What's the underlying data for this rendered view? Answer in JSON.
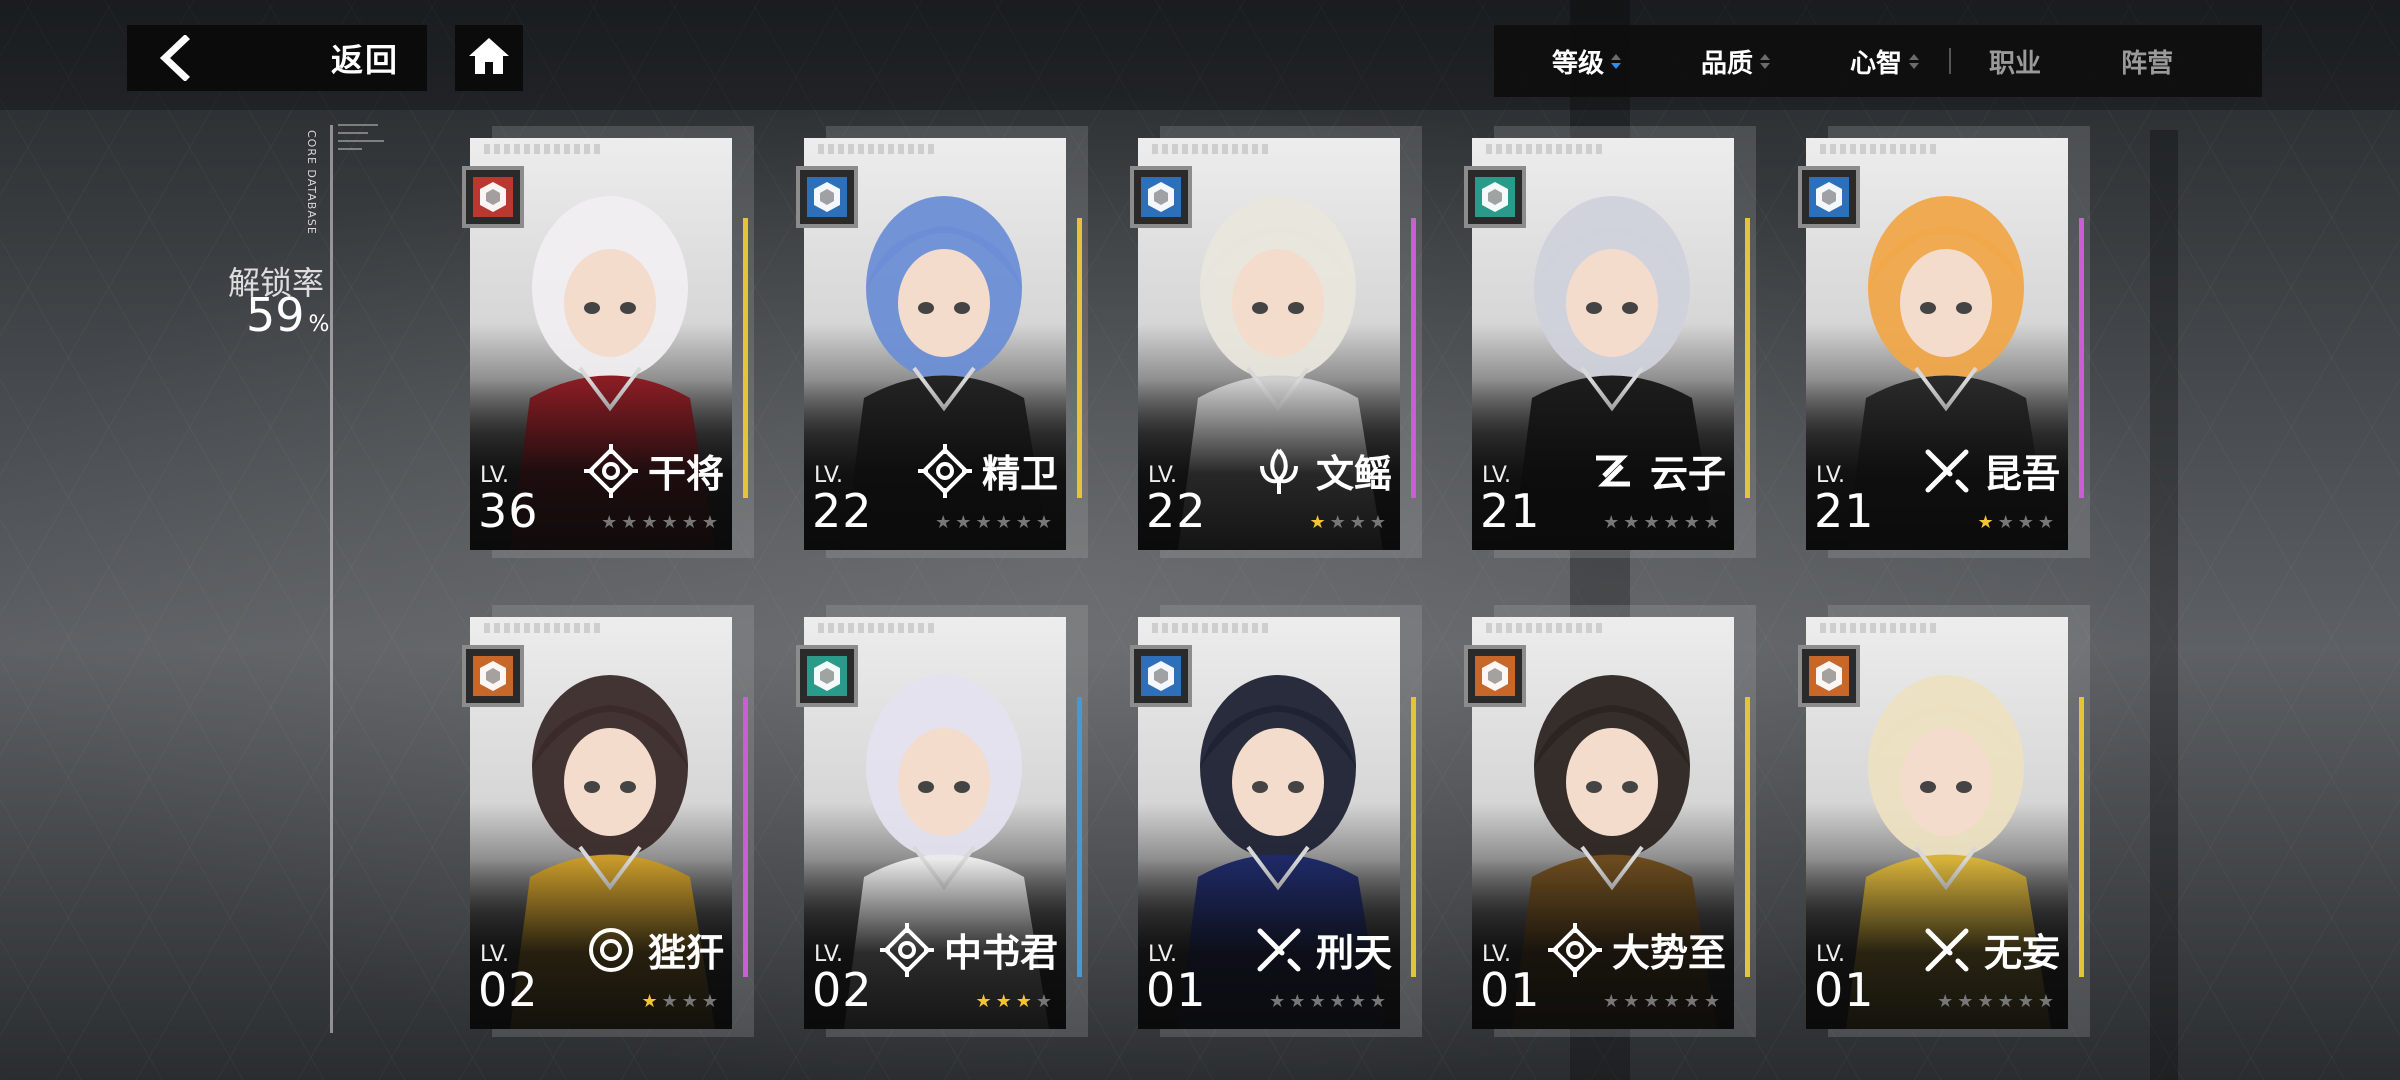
{
  "nav": {
    "back_label": "返回"
  },
  "sort": {
    "items": [
      {
        "label": "等级"
      },
      {
        "label": "品质"
      },
      {
        "label": "心智"
      }
    ],
    "filters": [
      {
        "label": "职业"
      },
      {
        "label": "阵营"
      }
    ]
  },
  "side": {
    "database_label": "CORE DATABASE",
    "unlock_title": "解锁率",
    "unlock_value": "59",
    "unlock_unit": "%"
  },
  "characters": [
    {
      "name": "干将",
      "lv_label": "LV.",
      "level": "36",
      "class_color": "#b8392f",
      "rarity_color": "#e6c33a",
      "stars_on": 0,
      "stars_total": 6
    },
    {
      "name": "精卫",
      "lv_label": "LV.",
      "level": "22",
      "class_color": "#2d6fb8",
      "rarity_color": "#e6c33a",
      "stars_on": 0,
      "stars_total": 6
    },
    {
      "name": "文鳐",
      "lv_label": "LV.",
      "level": "22",
      "class_color": "#2d6fb8",
      "rarity_color": "#c95ed6",
      "stars_on": 1,
      "stars_total": 4
    },
    {
      "name": "云子",
      "lv_label": "LV.",
      "level": "21",
      "class_color": "#2a9b8b",
      "rarity_color": "#e6c33a",
      "stars_on": 0,
      "stars_total": 6
    },
    {
      "name": "昆吾",
      "lv_label": "LV.",
      "level": "21",
      "class_color": "#2d6fb8",
      "rarity_color": "#c95ed6",
      "stars_on": 1,
      "stars_total": 4
    },
    {
      "name": "狴犴",
      "lv_label": "LV.",
      "level": "02",
      "class_color": "#c7672a",
      "rarity_color": "#c95ed6",
      "stars_on": 1,
      "stars_total": 4
    },
    {
      "name": "中书君",
      "lv_label": "LV.",
      "level": "02",
      "class_color": "#2a9b8b",
      "rarity_color": "#3f9be0",
      "stars_on": 3,
      "stars_total": 4
    },
    {
      "name": "刑天",
      "lv_label": "LV.",
      "level": "01",
      "class_color": "#2d6fb8",
      "rarity_color": "#e6c33a",
      "stars_on": 0,
      "stars_total": 6
    },
    {
      "name": "大势至",
      "lv_label": "LV.",
      "level": "01",
      "class_color": "#c7672a",
      "rarity_color": "#e6c33a",
      "stars_on": 0,
      "stars_total": 6
    },
    {
      "name": "无妄",
      "lv_label": "LV.",
      "level": "01",
      "class_color": "#c7672a",
      "rarity_color": "#e6c33a",
      "stars_on": 0,
      "stars_total": 6
    }
  ]
}
